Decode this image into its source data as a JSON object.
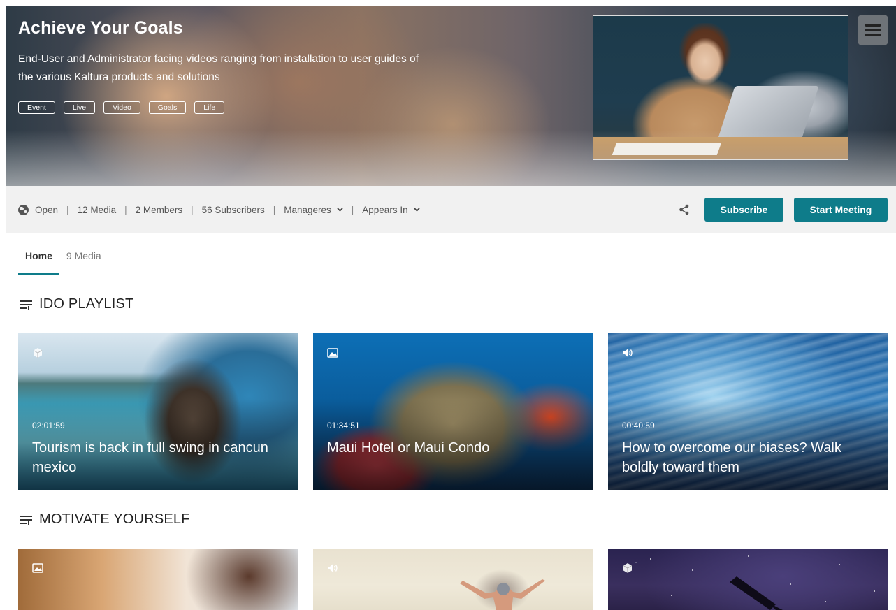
{
  "hero": {
    "title": "Achieve Your Goals",
    "description": "End-User and Administrator facing videos ranging from installation to user guides of the various Kaltura products and solutions",
    "tags": [
      "Event",
      "Live",
      "Video",
      "Goals",
      "Life"
    ]
  },
  "meta": {
    "visibility": "Open",
    "media_count": "12 Media",
    "members": "2 Members",
    "subscribers": "56 Subscribers",
    "managers_label": "Manageres",
    "appears_in_label": "Appears In",
    "separator": "|"
  },
  "actions": {
    "subscribe_label": "Subscribe",
    "start_meeting_label": "Start Meeting"
  },
  "tabs": [
    {
      "label": "Home",
      "active": true
    },
    {
      "label": "9 Media",
      "active": false
    }
  ],
  "sections": [
    {
      "title": "IDO PLAYLIST",
      "items": [
        {
          "type": "interactive",
          "duration": "02:01:59",
          "title": "Tourism is back in full swing in cancun mexico"
        },
        {
          "type": "image",
          "duration": "01:34:51",
          "title": "Maui Hotel or Maui Condo"
        },
        {
          "type": "audio",
          "duration": "00:40:59",
          "title": "How to overcome our biases? Walk boldly toward them"
        }
      ]
    },
    {
      "title": "MOTIVATE YOURSELF",
      "items": [
        {
          "type": "image"
        },
        {
          "type": "audio"
        },
        {
          "type": "interactive"
        }
      ]
    }
  ],
  "colors": {
    "accent": "#0e7c8a",
    "meta_bar_bg": "#f1f1f1"
  },
  "icons": {
    "visibility": "globe-icon",
    "share": "share-icon",
    "menu": "menu-icon",
    "playlist": "playlist-icon",
    "chevron": "chevron-down-icon"
  }
}
